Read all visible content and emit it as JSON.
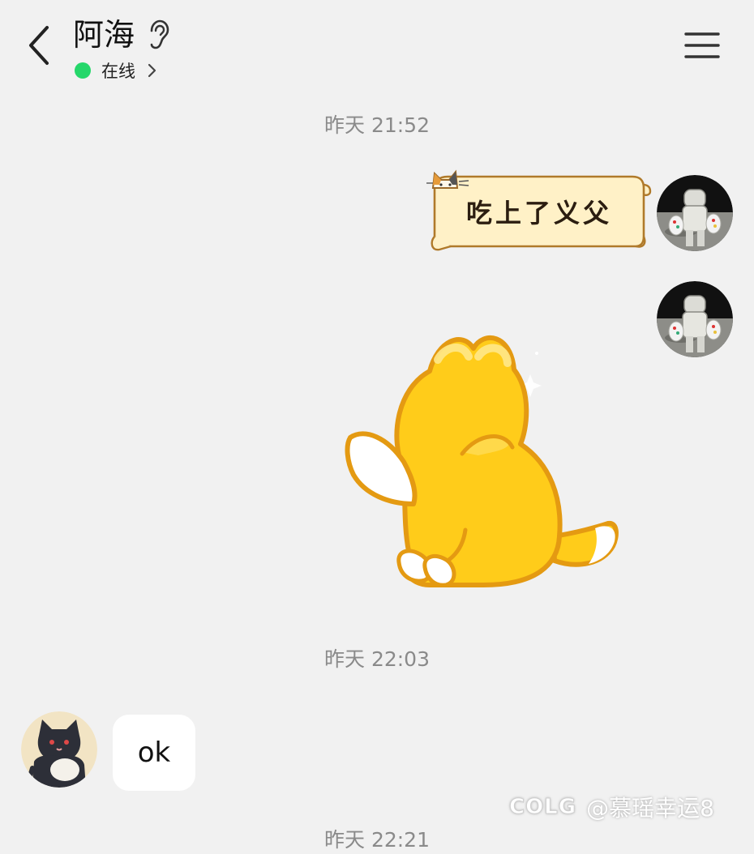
{
  "header": {
    "title": "阿海",
    "status_text": "在线",
    "icons": [
      "back-arrow-icon",
      "ear-icon",
      "chevron-right-icon",
      "menu-icon"
    ]
  },
  "messages": [
    {
      "type": "time",
      "text": "昨天 21:52"
    },
    {
      "type": "sticker-text",
      "side": "right",
      "text": "吃上了义父"
    },
    {
      "type": "sticker",
      "side": "right",
      "sticker": "yellow-cat-sitting-back"
    },
    {
      "type": "time",
      "text": "昨天 22:03"
    },
    {
      "type": "text",
      "side": "left",
      "text": "ok"
    },
    {
      "type": "time",
      "text": "昨天 22:21"
    }
  ],
  "watermark": {
    "logo": "COLG",
    "text": "@慕瑶幸运8"
  },
  "colors": {
    "background": "#f1f1f1",
    "online": "#25d76a",
    "bubble": "#ffffff",
    "time": "#8a8a8a",
    "cat_yellow": "#ffcc1a",
    "cat_outline": "#e49a12"
  }
}
